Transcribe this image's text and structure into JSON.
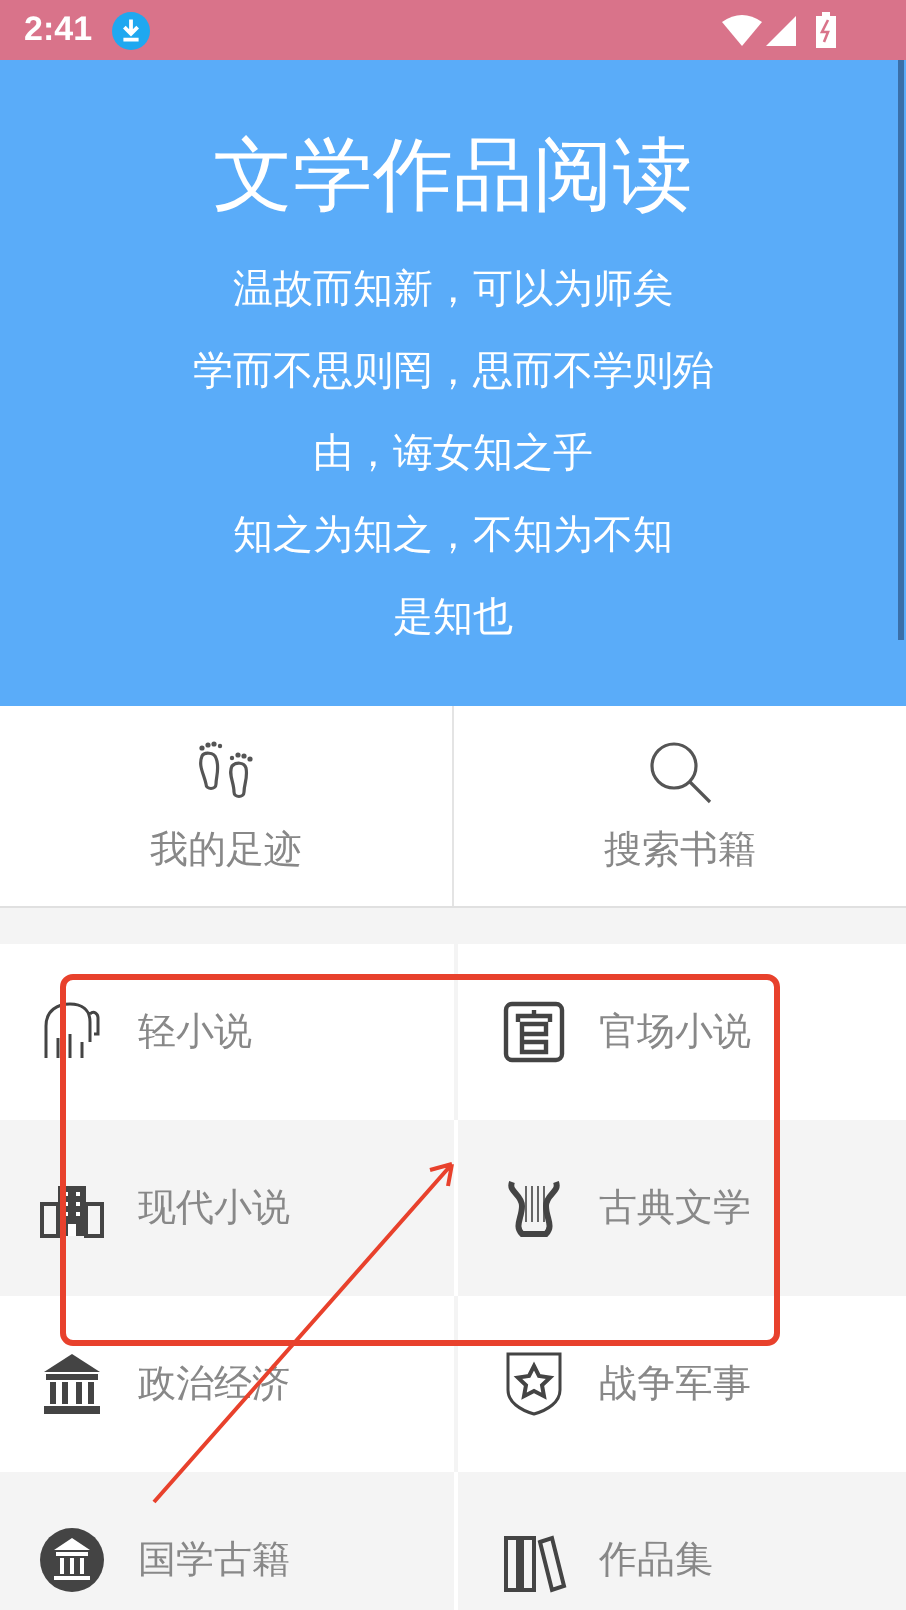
{
  "status_bar": {
    "time": "2:41"
  },
  "header": {
    "title": "文学作品阅读",
    "lines": [
      "温故而知新，可以为师矣",
      "学而不思则罔，思而不学则殆",
      "由，诲女知之乎",
      "知之为知之，不知为不知",
      "是知也"
    ]
  },
  "quick_actions": [
    {
      "label": "我的足迹"
    },
    {
      "label": "搜索书籍"
    }
  ],
  "categories": [
    {
      "label": "轻小说"
    },
    {
      "label": "官场小说"
    },
    {
      "label": "现代小说"
    },
    {
      "label": "古典文学"
    },
    {
      "label": "政治经济"
    },
    {
      "label": "战争军事"
    },
    {
      "label": "国学古籍"
    },
    {
      "label": "作品集"
    }
  ]
}
